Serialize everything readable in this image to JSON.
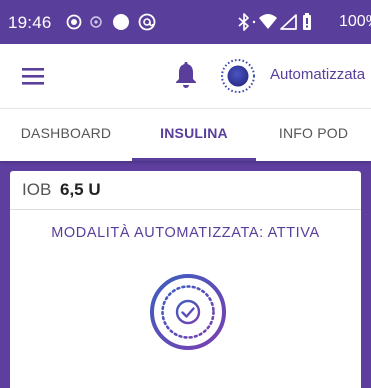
{
  "status_bar": {
    "time": "19:46",
    "battery": "100%",
    "icons": [
      "circle-dot-icon",
      "circle-small-icon",
      "circle-filled-icon",
      "at-circle-icon",
      "bluetooth-icon",
      "wifi-icon",
      "signal-icon",
      "battery-icon"
    ]
  },
  "app_bar": {
    "menu_icon": "hamburger-menu-icon",
    "notifications_icon": "bell-icon",
    "mode_icon": "automated-mode-icon",
    "mode_label": "Automatizzata"
  },
  "tabs": [
    {
      "label": "DASHBOARD",
      "active": false
    },
    {
      "label": "INSULINA",
      "active": true
    },
    {
      "label": "INFO POD",
      "active": false
    }
  ],
  "card": {
    "iob_label": "IOB",
    "iob_value": "6,5 U",
    "mode_status": "MODALITÀ AUTOMATIZZATA: ATTIVA",
    "mode_icon": "automated-active-check-icon"
  },
  "colors": {
    "primary": "#5a3e9c",
    "background": "#5e3fa0",
    "gradient_blue": "#3c5fbf",
    "gradient_purple": "#7a3fb0"
  }
}
